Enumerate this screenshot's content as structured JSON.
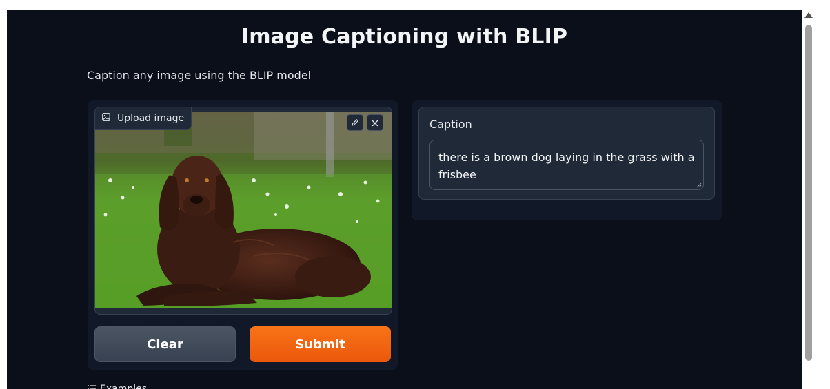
{
  "header": {
    "title": "Image Captioning with BLIP",
    "description": "Caption any image using the BLIP model"
  },
  "input_panel": {
    "image_label": "Upload image",
    "image_icon": "image-icon",
    "edit_icon": "pencil-icon",
    "close_icon": "close-icon",
    "image_content": "photo of a brown dog lying on grass"
  },
  "buttons": {
    "clear_label": "Clear",
    "submit_label": "Submit"
  },
  "output_panel": {
    "label": "Caption",
    "value": "there is a brown dog laying in the grass with a frisbee"
  },
  "examples": {
    "label": "Examples",
    "icon": "list-icon"
  },
  "colors": {
    "background": "#0b0f19",
    "panel": "#111827",
    "block": "#1f2937",
    "accent": "#f97316",
    "text": "#e5e7eb"
  }
}
